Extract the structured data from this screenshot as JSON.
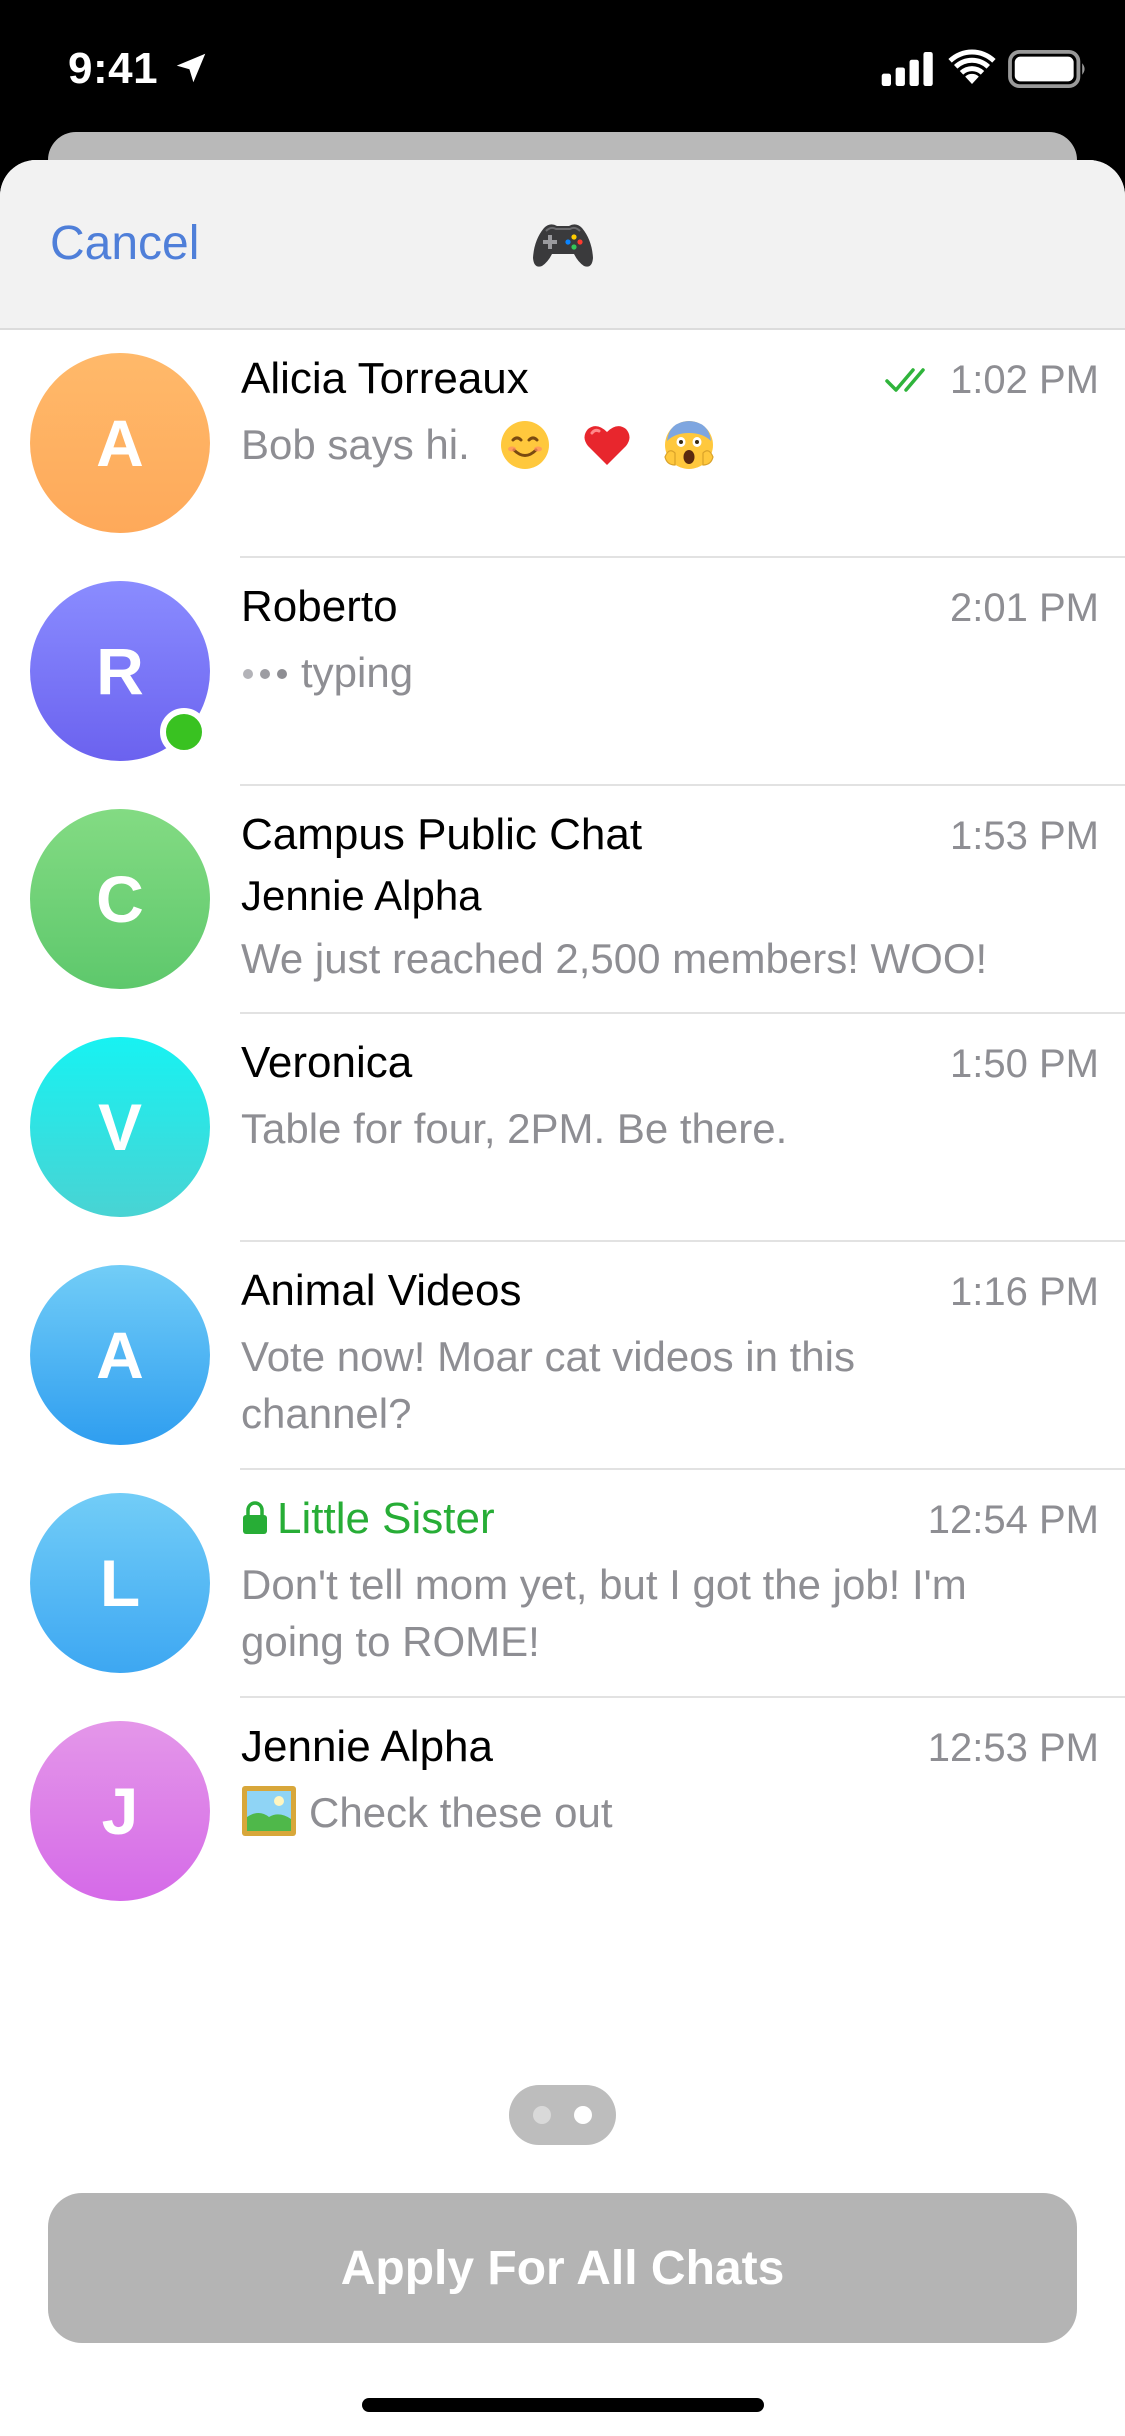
{
  "status_bar": {
    "time": "9:41",
    "icons": [
      "location-arrow-icon",
      "cellular-signal-icon",
      "wifi-icon",
      "battery-icon"
    ]
  },
  "header": {
    "cancel_label": "Cancel",
    "center_icon": "gamepad-emoji-icon"
  },
  "chats": [
    {
      "initial": "A",
      "name": "Alicia Torreaux",
      "time": "1:02 PM",
      "preview": "Bob says hi.",
      "preview_emojis": [
        "smiling-face-emoji",
        "red-heart-emoji",
        "screaming-face-emoji"
      ],
      "read_status": "double-check-icon",
      "avatar_colors": [
        "#ffb96a",
        "#fea95a"
      ]
    },
    {
      "initial": "R",
      "name": "Roberto",
      "time": "2:01 PM",
      "preview": "typing",
      "online": true,
      "avatar_colors": [
        "#8a8cff",
        "#6b62ef"
      ]
    },
    {
      "initial": "C",
      "name": "Campus Public Chat",
      "time": "1:53 PM",
      "author": "Jennie Alpha",
      "preview": "We just reached 2,500 members! WOO!",
      "avatar_colors": [
        "#83db83",
        "#5ec86c"
      ]
    },
    {
      "initial": "V",
      "name": "Veronica",
      "time": "1:50 PM",
      "preview": "Table for four, 2PM. Be there.",
      "avatar_colors": [
        "#17f2f2",
        "#49d3d3"
      ]
    },
    {
      "initial": "A",
      "name": "Animal Videos",
      "time": "1:16 PM",
      "preview": "Vote now! Moar cat videos in this channel?",
      "avatar_colors": [
        "#72cdf7",
        "#2f9ef0"
      ]
    },
    {
      "initial": "L",
      "name": "Little Sister",
      "time": "12:54 PM",
      "preview": "Don't tell mom yet, but I got the job! I'm going to ROME!",
      "secret": true,
      "title_color": "#27ad36",
      "avatar_colors": [
        "#72cdf7",
        "#3da7f2"
      ]
    },
    {
      "initial": "J",
      "name": "Jennie Alpha",
      "time": "12:53 PM",
      "preview": "Check these out",
      "preview_icon": "photo-icon",
      "avatar_colors": [
        "#e497e9",
        "#d56ae8"
      ]
    }
  ],
  "page_indicator": {
    "count": 2,
    "active": 2
  },
  "apply_button_label": "Apply For All Chats",
  "colors": {
    "accent": "#4f7fd9",
    "secret_chat": "#27ad36",
    "online_dot": "#39c221",
    "secondary_text": "#8e8e93",
    "button_disabled": "#b4b4b4"
  }
}
